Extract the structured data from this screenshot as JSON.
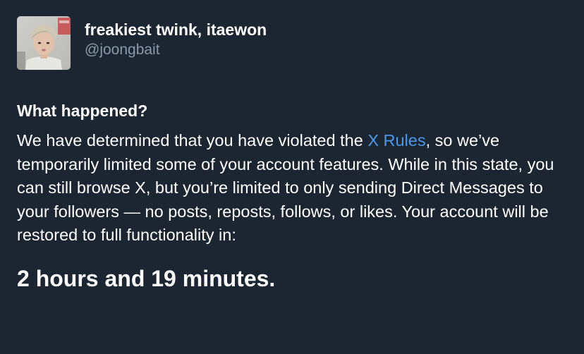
{
  "profile": {
    "display_name": "freakiest twink, itaewon",
    "handle": "@joongbait"
  },
  "notice": {
    "heading": "What happened?",
    "body_before_link": "We have determined that you have violated the ",
    "link_text": "X Rules",
    "body_after_link": ", so we’ve temporarily limited some of your account features. While in this state, you can still browse X, but you’re limited to only sending Direct Messages to your followers — no posts, reposts, follows, or likes. Your account will be restored to full functionality in:",
    "countdown": "2 hours and 19 minutes."
  },
  "colors": {
    "background": "#1b2632",
    "text": "#ffffff",
    "muted": "#8b98a5",
    "link": "#4a99e9"
  }
}
